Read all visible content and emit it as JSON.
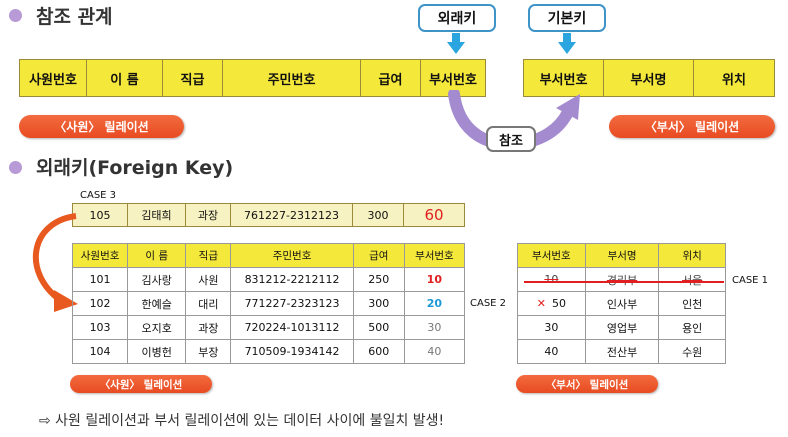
{
  "section1": {
    "title": "참조 관계"
  },
  "section2": {
    "title": "외래키(Foreign Key)"
  },
  "keys": {
    "foreign": "외래키",
    "primary": "기본키"
  },
  "ref_label": "참조",
  "emp_header": [
    "사원번호",
    "이 름",
    "직급",
    "주민번호",
    "급여",
    "부서번호"
  ],
  "dept_header": [
    "부서번호",
    "부서명",
    "위치"
  ],
  "emp_relation_label": "〈사원〉 릴레이션",
  "dept_relation_label": "〈부서〉 릴레이션",
  "case3": {
    "label": "CASE 3",
    "row": [
      "105",
      "김태희",
      "과장",
      "761227-2312123",
      "300",
      "60"
    ]
  },
  "emp_table": {
    "header": [
      "사원번호",
      "이 름",
      "직급",
      "주민번호",
      "급여",
      "부서번호"
    ],
    "rows": [
      [
        "101",
        "김사랑",
        "사원",
        "831212-2212112",
        "250",
        "10"
      ],
      [
        "102",
        "한예슬",
        "대리",
        "771227-2323123",
        "300",
        "20"
      ],
      [
        "103",
        "오지호",
        "과장",
        "720224-1013112",
        "500",
        "30"
      ],
      [
        "104",
        "이병헌",
        "부장",
        "710509-1934142",
        "600",
        "40"
      ]
    ]
  },
  "dept_table": {
    "header": [
      "부서번호",
      "부서명",
      "위치"
    ],
    "rows": [
      [
        "10",
        "경리부",
        "서울"
      ],
      [
        "50",
        "인사부",
        "인천"
      ],
      [
        "30",
        "영업부",
        "용인"
      ],
      [
        "40",
        "전산부",
        "수원"
      ]
    ]
  },
  "case1_label": "CASE 1",
  "case2_label": "CASE 2",
  "note": "⇨ 사원 릴레이션과 부서 릴레이션에 있는 데이터 사이에 불일치 발생!",
  "colors": {
    "highlight": "#f4e83a",
    "pill": "#e84b22",
    "arrow_blue": "#2aa5e0",
    "arrow_purple": "#a48bd0",
    "red_value": "#e02020",
    "blue_value": "#1a9ad6"
  }
}
